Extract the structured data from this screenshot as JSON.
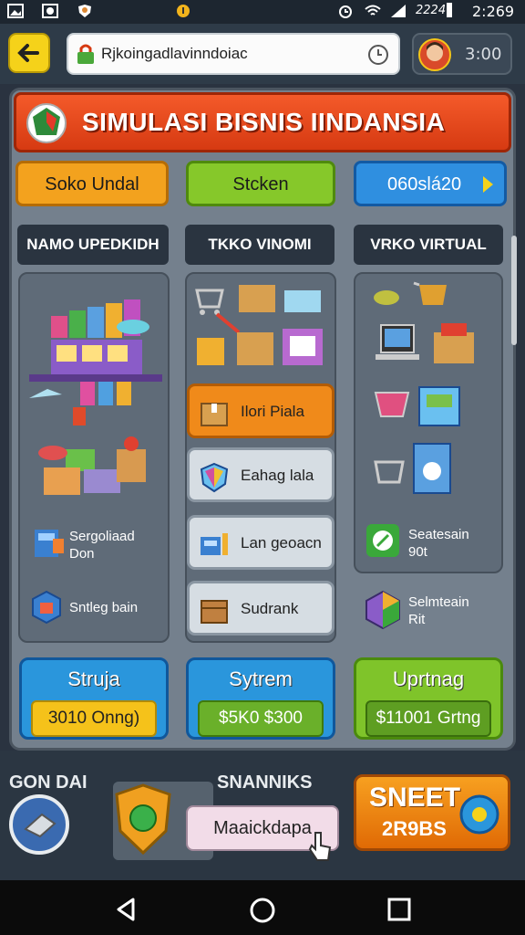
{
  "status_bar": {
    "left_icons": [
      "gallery-icon",
      "image-icon",
      "shield-icon",
      "notification-icon"
    ],
    "carrier": "2224",
    "time": "2:269"
  },
  "browser": {
    "url": "Rjkoingadlavinndoiac",
    "time_badge": "3:00"
  },
  "banner": {
    "title": "SIMULASI BISNIS IINDANSIA"
  },
  "tabs": [
    "Soko Undal",
    "Stcken",
    "060slá20"
  ],
  "columns": [
    {
      "header": "NAMO UPEDKIDH"
    },
    {
      "header": "TKKO VINOMI"
    },
    {
      "header": "VRKO VIRTUAL"
    }
  ],
  "col1_items": [
    {
      "label": "Sergoliaad\nDon"
    },
    {
      "label": "Sntleg bain"
    }
  ],
  "col2_items": [
    {
      "label": "Ilori Piala"
    },
    {
      "label": "Eahag lala"
    },
    {
      "label": "Lan geoacn"
    },
    {
      "label": "Sudrank"
    }
  ],
  "col3_items": [
    {
      "label": "Seatesain\n90t"
    },
    {
      "label": "Selmteain\nRit"
    }
  ],
  "action_buttons": [
    {
      "title": "Struja",
      "value": "3010 Onng)"
    },
    {
      "title": "Sytrem",
      "value": "$5K0 $300"
    },
    {
      "title": "Uprtnag",
      "value": "$11001 Grtng"
    }
  ],
  "bottom": {
    "left_label": "GON DAI",
    "center_label": "SNANNIKS",
    "center_button": "Maaickdapa",
    "right_button_line1": "SNEET",
    "right_button_line2": "2R9BS"
  },
  "colors": {
    "banner": "#e2461a",
    "orange": "#f28a1a",
    "green": "#7cbf1e",
    "blue": "#2b8fd8",
    "yellow": "#f5d21a"
  }
}
